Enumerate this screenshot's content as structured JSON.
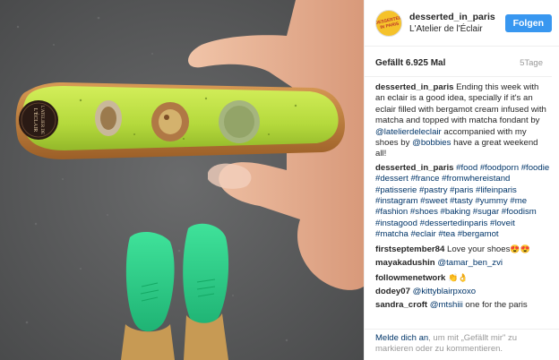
{
  "header": {
    "avatar_text": "DESSERTED IN PARIS",
    "username": "desserted_in_paris",
    "location": "L'Atelier de l'Éclair",
    "follow_label": "Folgen"
  },
  "stats": {
    "likes": "Gefällt 6.925 Mal",
    "time": "5Tage"
  },
  "caption": {
    "user": "desserted_in_paris",
    "text1": " Ending this week with an eclair is a good idea, specially if it's an eclair filled with bergamot cream infused with matcha and topped with matcha fondant by ",
    "mention1": "@latelierdeleclair",
    "text2": " accompanied with my shoes by ",
    "mention2": "@bobbies",
    "text3": " have a great weekend all!"
  },
  "hashtags": {
    "user": "desserted_in_paris",
    "tags": "#food #foodporn #foodie #dessert #france #fromwhereistand #patisserie #pastry #paris #lifeinparis #instagram #sweet #tasty #yummy #me #fashion #shoes #baking #sugar #foodism #instagood #dessertedinparis #loveit #matcha #eclair #tea #bergamot"
  },
  "comments": [
    {
      "user": "firstseptember84",
      "text": "Love your shoes",
      "emoji": "😍😍"
    },
    {
      "user": "mayakadushin",
      "mention": "@tamar_ben_zvi",
      "text": ""
    },
    {
      "user": "followmenetwork",
      "text": "",
      "emoji": "👏👌"
    },
    {
      "user": "dodey07",
      "mention": "@kittyblairpxoxo",
      "text": ""
    },
    {
      "user": "sandra_croft",
      "mention": "@mtshiii",
      "text": " one for the paris"
    }
  ],
  "footer": {
    "login": "Melde dich an",
    "text": ", um mit „Gefällt mir\" zu markieren oder zu kommentieren."
  },
  "photo": {
    "eclair_brand": "L'ATELIER DE L'ÉCLAIR",
    "colors": {
      "asphalt": "#5d5e5f",
      "eclair_glaze": "#b7dc3e",
      "pastry": "#c4833e",
      "shoes": "#2fd38a",
      "skin": "#e8b59a"
    }
  }
}
